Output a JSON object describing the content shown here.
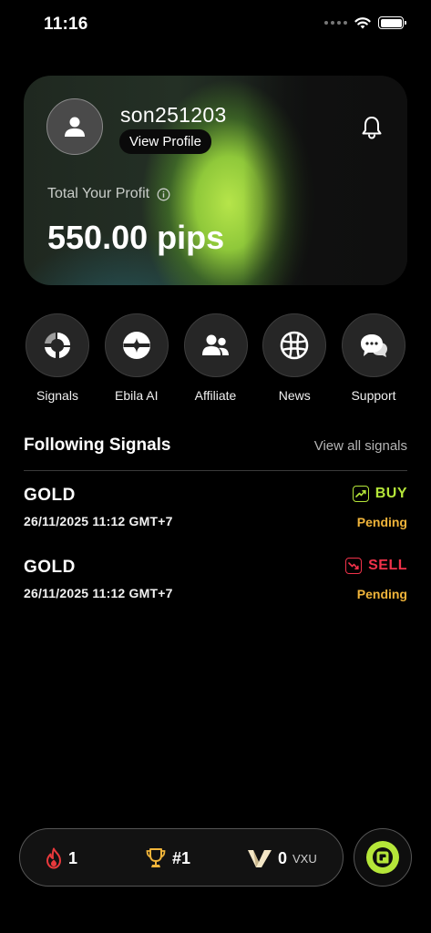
{
  "status_bar": {
    "time": "11:16"
  },
  "profile": {
    "username": "son251203",
    "view_profile_label": "View Profile",
    "profit_label": "Total Your Profit",
    "profit_value": "550.00 pips"
  },
  "actions": [
    {
      "label": "Signals",
      "icon": "signals-icon"
    },
    {
      "label": "Ebila AI",
      "icon": "ai-icon"
    },
    {
      "label": "Affiliate",
      "icon": "users-icon"
    },
    {
      "label": "News",
      "icon": "news-globe-icon"
    },
    {
      "label": "Support",
      "icon": "chat-bubbles-icon"
    }
  ],
  "following": {
    "title": "Following Signals",
    "view_all": "View all signals",
    "signals": [
      {
        "symbol": "GOLD",
        "time": "26/11/2025 11:12 GMT+7",
        "direction": "BUY",
        "status": "Pending",
        "color": "#b5e639"
      },
      {
        "symbol": "GOLD",
        "time": "26/11/2025 11:12 GMT+7",
        "direction": "SELL",
        "status": "Pending",
        "color": "#f0324a"
      }
    ]
  },
  "bottom_bar": {
    "streak": "1",
    "rank": "#1",
    "vxu_value": "0",
    "vxu_label": "VXU"
  },
  "colors": {
    "accent": "#b5e639",
    "buy": "#b5e639",
    "sell": "#f0324a",
    "pending": "#f0b43a"
  }
}
